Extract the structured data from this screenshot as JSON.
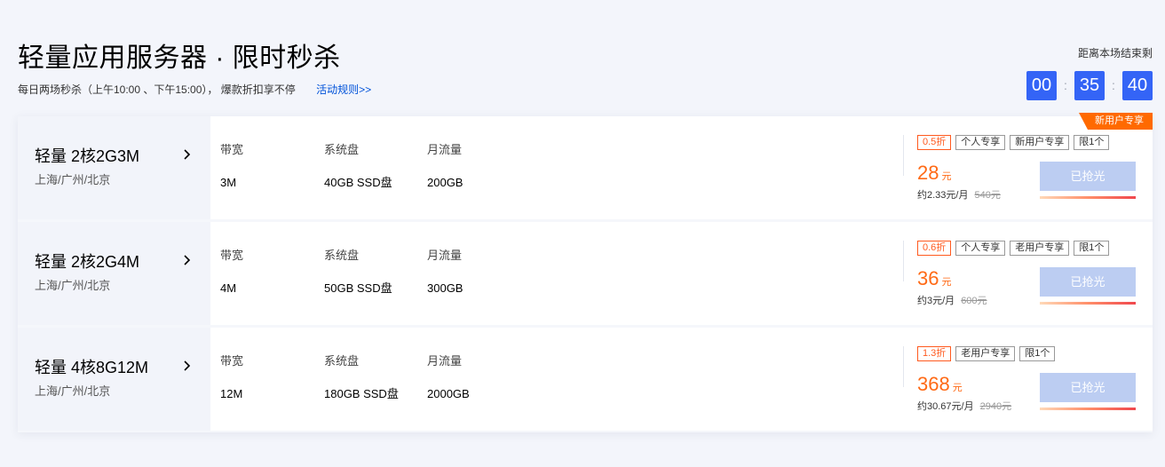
{
  "header": {
    "title": "轻量应用服务器 · 限时秒杀",
    "subtitle": "每日两场秒杀（上午10:00 、下午15:00）， 爆款折扣享不停",
    "rules_link": "活动规则>>"
  },
  "countdown": {
    "label": "距离本场结束剩",
    "hours": "00",
    "minutes": "35",
    "seconds": "40",
    "separator": ":"
  },
  "spec_labels": {
    "bandwidth": "带宽",
    "disk": "系统盘",
    "traffic": "月流量"
  },
  "products": [
    {
      "name": "轻量 2核2G3M",
      "region": "上海/广州/北京",
      "bandwidth": "3M",
      "disk": "40GB SSD盘",
      "traffic": "200GB",
      "tags": [
        "0.5折",
        "个人专享",
        "新用户专享",
        "限1个"
      ],
      "price": "28",
      "price_unit": "元",
      "monthly": "约2.33元/月",
      "original": "540元",
      "button": "已抢光",
      "sold_fraction": 1.0,
      "corner_badge": "新用户专享"
    },
    {
      "name": "轻量 2核2G4M",
      "region": "上海/广州/北京",
      "bandwidth": "4M",
      "disk": "50GB SSD盘",
      "traffic": "300GB",
      "tags": [
        "0.6折",
        "个人专享",
        "老用户专享",
        "限1个"
      ],
      "price": "36",
      "price_unit": "元",
      "monthly": "约3元/月",
      "original": "600元",
      "button": "已抢光",
      "sold_fraction": 1.0
    },
    {
      "name": "轻量 4核8G12M",
      "region": "上海/广州/北京",
      "bandwidth": "12M",
      "disk": "180GB SSD盘",
      "traffic": "2000GB",
      "tags": [
        "1.3折",
        "老用户专享",
        "限1个"
      ],
      "price": "368",
      "price_unit": "元",
      "monthly": "约30.67元/月",
      "original": "2940元",
      "button": "已抢光",
      "sold_fraction": 1.0
    }
  ],
  "colors": {
    "accent": "#3464f6",
    "price": "#ff6a16",
    "badge": "#ff6a00",
    "disabled_button": "#bccdf2"
  },
  "icons": {
    "chevron": "chevron-right-icon"
  }
}
